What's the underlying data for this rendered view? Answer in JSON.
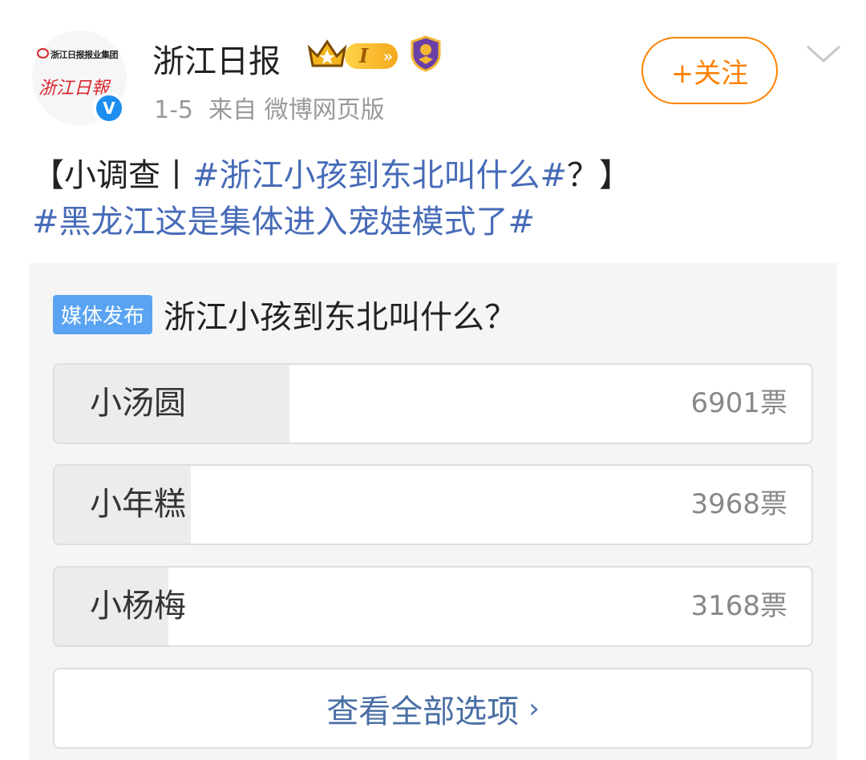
{
  "header": {
    "avatar_logo_small": "浙江日报报业集团",
    "avatar_logo_main": "浙江日報",
    "user_name": "浙江日报",
    "level": "I",
    "post_date": "1-5",
    "post_source": "来自 微博网页版",
    "follow_label": "+关注",
    "verified_mark": "V"
  },
  "post": {
    "prefix": "【小调查丨",
    "topic1": "#浙江小孩到东北叫什么#",
    "suffix": "？】",
    "topic2": "#黑龙江这是集体进入宠娃模式了#"
  },
  "poll": {
    "tag": "媒体发布",
    "question": "浙江小孩到东北叫什么？",
    "options": [
      {
        "label": "小汤圆",
        "votes": "6901票",
        "share": 0.31
      },
      {
        "label": "小年糕",
        "votes": "3968票",
        "share": 0.18
      },
      {
        "label": "小杨梅",
        "votes": "3168票",
        "share": 0.15
      }
    ],
    "view_all": "查看全部选项",
    "view_all_chevron": "›"
  },
  "colors": {
    "accent_orange": "#ff8200",
    "topic_blue": "#476bb8",
    "verified_blue": "#1d8ef0",
    "media_tag_blue": "#5aa3f2"
  },
  "icons": [
    "crown-icon",
    "shield-icon",
    "chevron-down-icon",
    "verified-icon"
  ]
}
